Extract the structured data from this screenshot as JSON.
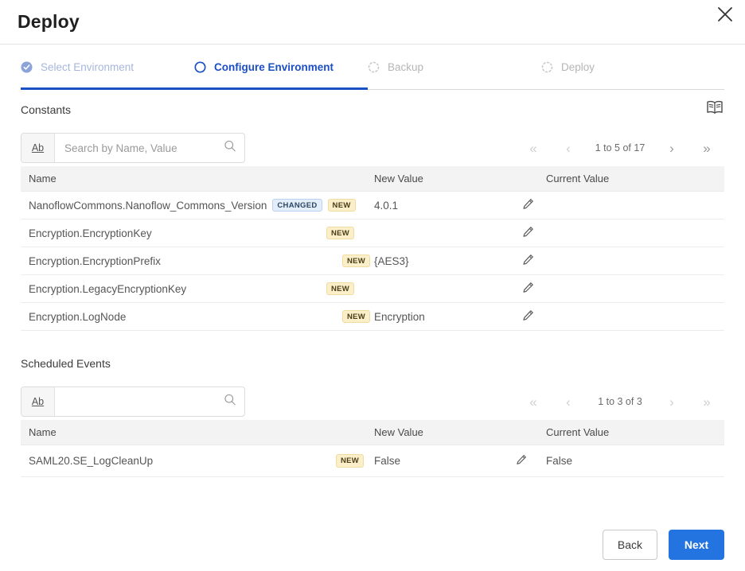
{
  "window": {
    "title": "Deploy",
    "close_icon": "close-icon"
  },
  "stepper": {
    "steps": [
      {
        "label": "Select Environment",
        "state": "done",
        "icon": "check-circle-filled-icon"
      },
      {
        "label": "Configure Environment",
        "state": "current",
        "icon": "circle-outline-icon"
      },
      {
        "label": "Backup",
        "state": "todo",
        "icon": "dotted-circle-icon"
      },
      {
        "label": "Deploy",
        "state": "todo",
        "icon": "dotted-circle-icon"
      }
    ]
  },
  "constants": {
    "title": "Constants",
    "dictionary_icon": "open-book-icon",
    "search": {
      "prefix_label": "Ab",
      "value": "",
      "placeholder": "Search by Name, Value",
      "icon": "search-icon"
    },
    "pager": {
      "first_label": "«",
      "prev_label": "‹",
      "summary": "1 to 5 of 17",
      "next_label": "›",
      "last_label": "»"
    },
    "columns": [
      "Name",
      "New Value",
      "Current Value"
    ],
    "rows": [
      {
        "name": "NanoflowCommons.Nanoflow_Commons_Version",
        "badges": [
          "CHANGED",
          "NEW"
        ],
        "new_value": "4.0.1",
        "current_value": "",
        "edit_icon": "pencil-icon"
      },
      {
        "name": "Encryption.EncryptionKey",
        "badges": [
          "NEW"
        ],
        "new_value": "",
        "current_value": "",
        "edit_icon": "pencil-icon"
      },
      {
        "name": "Encryption.EncryptionPrefix",
        "badges": [
          "NEW"
        ],
        "new_value": "{AES3}",
        "current_value": "",
        "edit_icon": "pencil-icon"
      },
      {
        "name": "Encryption.LegacyEncryptionKey",
        "badges": [
          "NEW"
        ],
        "new_value": "",
        "current_value": "",
        "edit_icon": "pencil-icon"
      },
      {
        "name": "Encryption.LogNode",
        "badges": [
          "NEW"
        ],
        "new_value": "Encryption",
        "current_value": "",
        "edit_icon": "pencil-icon"
      }
    ]
  },
  "scheduled_events": {
    "title": "Scheduled Events",
    "search": {
      "prefix_label": "Ab",
      "value": "",
      "placeholder": "",
      "icon": "search-icon"
    },
    "pager": {
      "first_label": "«",
      "prev_label": "‹",
      "summary": "1 to 3 of 3",
      "next_label": "›",
      "last_label": "»"
    },
    "columns": [
      "Name",
      "New Value",
      "Current Value"
    ],
    "rows": [
      {
        "name": "SAML20.SE_LogCleanUp",
        "badges": [
          "NEW"
        ],
        "new_value": "False",
        "current_value": "False",
        "edit_icon": "pencil-icon"
      }
    ]
  },
  "footer": {
    "back_label": "Back",
    "next_label": "Next"
  },
  "colors": {
    "accent_blue": "#2374e1",
    "step_active": "#1b4fc4",
    "badge_changed_bg": "#e4eefb",
    "badge_new_bg": "#fbefc9",
    "header_row_bg": "#f3f3f3"
  }
}
